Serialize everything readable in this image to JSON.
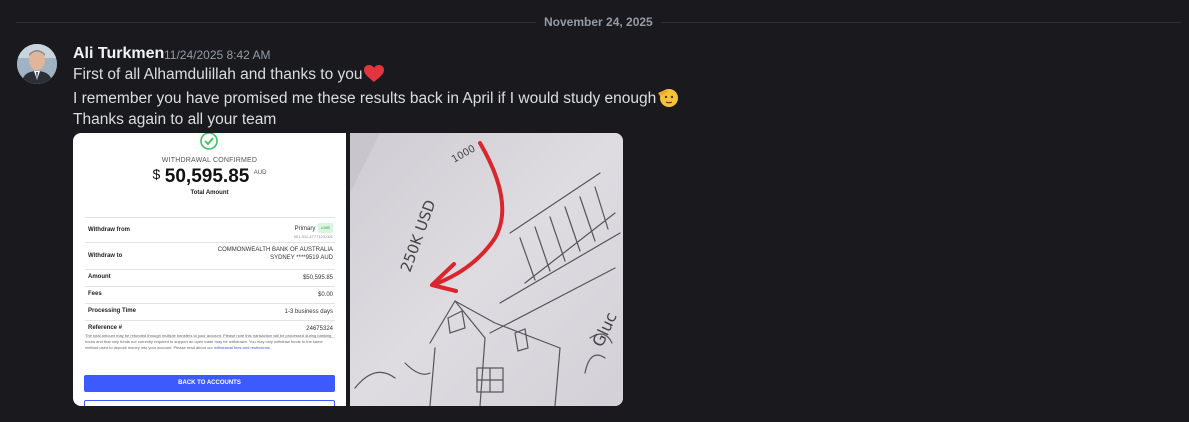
{
  "date_divider": "November 24, 2025",
  "message": {
    "author": "Ali Turkmen",
    "timestamp": "11/24/2025 8:42 AM",
    "lines": [
      "First of all Alhamdulillah and thanks to you",
      "I remember you have promised me these results back in April if I would study enough",
      "Thanks again to all your team"
    ],
    "line1_emoji": "red-heart-icon",
    "line2_emoji": "saluting-face-icon"
  },
  "receipt": {
    "status": "WITHDRAWAL CONFIRMED",
    "currency_symbol": "$",
    "amount": "50,595.85",
    "currency_code": "AUD",
    "total_label": "Total Amount",
    "rows": [
      {
        "label": "Withdraw from",
        "value": "Primary",
        "badge": "LIVE",
        "sub": "001-011-4777123-001"
      },
      {
        "label": "Withdraw to",
        "value": "COMMONWEALTH BANK OF AUSTRALIA",
        "sub": "SYDNEY ****9519 AUD"
      },
      {
        "label": "Amount",
        "value": "$50,595.85"
      },
      {
        "label": "Fees",
        "value": "$0.00"
      },
      {
        "label": "Processing Time",
        "value": "1-3 business days"
      },
      {
        "label": "Reference #",
        "value": "24675324"
      }
    ],
    "disclaimer": "The total amount may be refunded through multiple transfers to your account. Please note this transaction will be processed during banking hours and that only funds not currently required to support an open trade may be withdrawn. You may only withdraw funds to the same method used to deposit money into your account. Please read about our",
    "disclaimer_link": "withdrawal fees and restrictions.",
    "button_label": "BACK TO ACCOUNTS"
  },
  "drawing": {
    "text_250k": "250K USD",
    "text_top": "1000",
    "text_right": "Gluc"
  }
}
